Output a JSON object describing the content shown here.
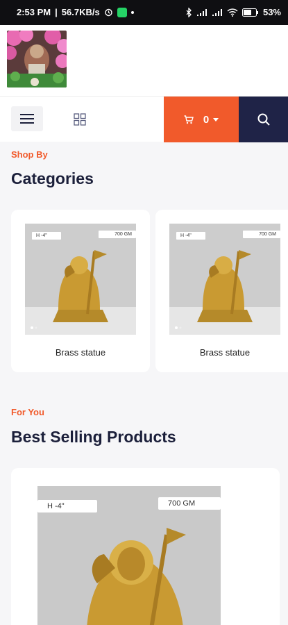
{
  "status_bar": {
    "time": "2:53 PM",
    "speed": "56.7KB/s",
    "battery": "53%"
  },
  "toolbar": {
    "cart_count": "0"
  },
  "categories_section": {
    "eyebrow": "Shop By",
    "title": "Categories",
    "items": [
      {
        "name": "Brass statue",
        "height_tag": "H -4\"",
        "weight_tag": "700 GM"
      },
      {
        "name": "Brass statue",
        "height_tag": "H -4\"",
        "weight_tag": "700 GM"
      }
    ]
  },
  "products_section": {
    "eyebrow": "For You",
    "title": "Best Selling Products",
    "items": [
      {
        "height_tag": "H -4\"",
        "weight_tag": "700 GM"
      }
    ]
  },
  "colors": {
    "accent": "#f15a2b",
    "navy": "#1f2347"
  }
}
